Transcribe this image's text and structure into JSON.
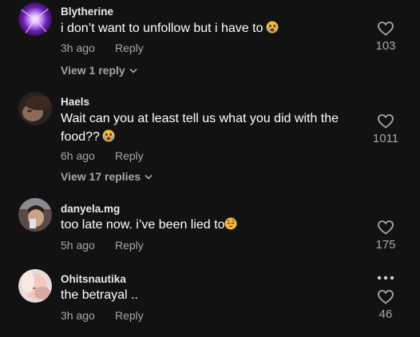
{
  "comments": [
    {
      "username": "Blytherine",
      "text": "i don’t want to unfollow but i have to",
      "emoji": "crying-face-emoji",
      "time": "3h ago",
      "reply_label": "Reply",
      "view_replies": "View 1 reply",
      "likes": "103"
    },
    {
      "username": "Haels",
      "text": "Wait can you at least tell us what you did with the food??",
      "emoji": "crying-face-emoji",
      "time": "6h ago",
      "reply_label": "Reply",
      "view_replies": "View 17 replies",
      "likes": "1011"
    },
    {
      "username": "danyela.mg",
      "text": "too late now. i’ve been lied to",
      "emoji": "pensive-face-emoji",
      "time": "5h ago",
      "reply_label": "Reply",
      "likes": "175"
    },
    {
      "username": "Ohitsnautika",
      "text": "the betrayal ..",
      "time": "3h ago",
      "reply_label": "Reply",
      "likes": "46"
    }
  ],
  "colors": {
    "background": "#121212",
    "text": "#ffffff",
    "muted": "#a6a6a6",
    "emoji": "#f5b83d"
  }
}
